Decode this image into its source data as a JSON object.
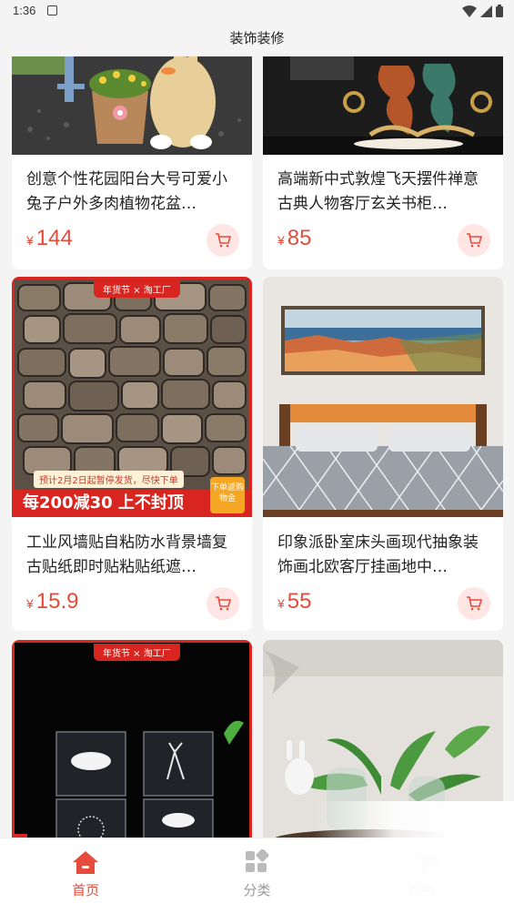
{
  "status_bar": {
    "time": "1:36"
  },
  "header": {
    "title": "装饰装修"
  },
  "products": [
    {
      "title": "创意个性花园阳台大号可爱小兔子户外多肉植物花盆…",
      "currency": "¥",
      "price": "144"
    },
    {
      "title": "高端新中式敦煌飞天摆件禅意古典人物客厅玄关书柜…",
      "currency": "¥",
      "price": "85"
    },
    {
      "title": "工业风墙贴自粘防水背景墙复古贴纸即时贴粘贴纸遮…",
      "currency": "¥",
      "price": "15.9"
    },
    {
      "title": "印象派卧室床头画现代抽象装饰画北欧客厅挂画地中…",
      "currency": "¥",
      "price": "55"
    }
  ],
  "promo": {
    "top_tag": "年货节 × 淘工厂",
    "bottom_banner": "每200减30 上不封顶",
    "note": "预计2月2日起暂停发货，尽快下单",
    "badge": "下单返购物金"
  },
  "tabbar": {
    "items": [
      {
        "label": "首页",
        "icon": "home-icon",
        "active": true
      },
      {
        "label": "分类",
        "icon": "category-icon",
        "active": false
      },
      {
        "label": "购物车",
        "icon": "cart-icon",
        "active": false
      }
    ]
  },
  "colors": {
    "accent": "#e64b3c",
    "accent_light": "#fde6e4",
    "background": "#f4f4f4"
  }
}
